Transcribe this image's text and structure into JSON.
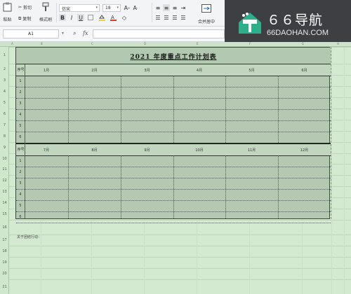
{
  "ribbon": {
    "paste_label": "粘贴",
    "cut_label": "剪切",
    "copy_label": "复制",
    "format_painter_label": "格式刷",
    "font_name": "仿宋",
    "font_size": "18",
    "merge_center_label": "合并居中"
  },
  "watermark": {
    "brand": "６６导航",
    "url": "66DAOHAN.COM"
  },
  "formula_bar": {
    "cell_ref": "A1",
    "fx": "fx",
    "formula": ""
  },
  "sheet": {
    "col_headers": [
      "A",
      "B",
      "C",
      "D",
      "E",
      "F",
      "G",
      "H"
    ],
    "row_numbers": [
      "1",
      "2",
      "3",
      "4",
      "5",
      "6",
      "7",
      "8",
      "9",
      "10",
      "11",
      "12",
      "13",
      "14",
      "15",
      "16",
      "17",
      "18",
      "19",
      "20",
      "21"
    ],
    "title": "2021 年度重点工作计划表",
    "seq_label_top": "序号",
    "seq_label_bottom": "序号",
    "months_top": [
      "1月",
      "2月",
      "3月",
      "4月",
      "5月",
      "6月"
    ],
    "months_bottom": [
      "7月",
      "8月",
      "9月",
      "10月",
      "11月",
      "12月"
    ],
    "row_indices_top": [
      "1",
      "2",
      "3",
      "4",
      "5",
      "6"
    ],
    "row_indices_bottom": [
      "1",
      "2",
      "3",
      "4",
      "5",
      "6"
    ],
    "footnote": "关于团结行动："
  }
}
